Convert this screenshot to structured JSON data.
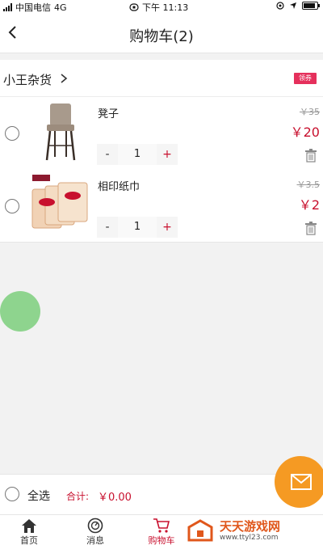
{
  "status_bar": {
    "carrier": "中国电信",
    "network": "4G",
    "time": "下午 11:13"
  },
  "header": {
    "back_icon": "chevron-left-icon",
    "title": "购物车(2)"
  },
  "store": {
    "name": "小王杂货",
    "coupon_label": "领券"
  },
  "cart_items": [
    {
      "name": "凳子",
      "original_price": "￥35",
      "price": "￥20",
      "quantity": "1",
      "minus": "-",
      "plus": "+",
      "image": "bar-stool-image"
    },
    {
      "name": "相印纸巾",
      "original_price": "￥3.5",
      "price": "￥2",
      "quantity": "1",
      "minus": "-",
      "plus": "+",
      "image": "tissue-pack-image"
    }
  ],
  "footer": {
    "select_all": "全选",
    "total_label": "合计:",
    "total_value": "￥0.00"
  },
  "tabs": [
    {
      "label": "首页",
      "icon": "home-icon"
    },
    {
      "label": "消息",
      "icon": "message-icon"
    },
    {
      "label": "购物车",
      "icon": "cart-icon",
      "active": true
    }
  ],
  "watermark": {
    "title": "天天游戏网",
    "url": "www.ttyl23.com"
  },
  "colors": {
    "accent": "#c8102e",
    "coupon": "#e5305c",
    "fab": "#f59a23",
    "float_button": "#8ed48e"
  }
}
